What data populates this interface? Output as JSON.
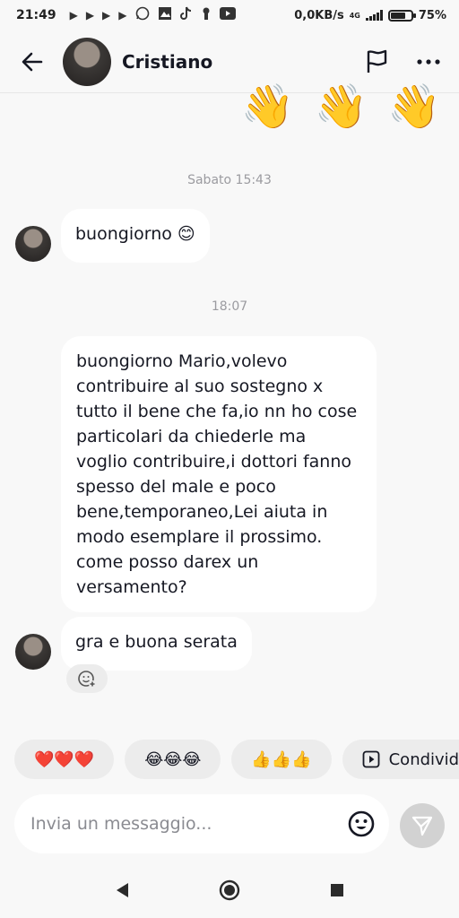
{
  "status_bar": {
    "time": "21:49",
    "net_speed": "0,0KB/s",
    "network_type": "4G",
    "battery": "75%",
    "battery_level": 0.75,
    "icons": [
      "play-icon",
      "play-icon",
      "play-icon",
      "play-icon",
      "whatsapp-icon",
      "image-icon",
      "tiktok-icon",
      "keyhole-icon",
      "youtube-icon"
    ]
  },
  "header": {
    "name": "Cristiano",
    "back_icon": "arrow-left-icon",
    "report_icon": "flag-icon",
    "more_icon": "more-horizontal-icon"
  },
  "chat": {
    "top_reactions": [
      "👋",
      "👋",
      "👋"
    ],
    "timestamp_1": "Sabato 15:43",
    "message_1": "buongiorno 😊",
    "timestamp_2": "18:07",
    "message_2": "buongiorno Mario,volevo contribuire al suo sostegno x tutto il bene che fa,io nn ho cose particolari da chiederle ma voglio contribuire,i dottori fanno spesso del male e poco bene,temporaneo,Lei aiuta in modo esemplare il prossimo. come posso darex un versamento?",
    "message_3": "gra e buona serata"
  },
  "quick_replies": [
    "❤️❤️❤️",
    "😂😂😂",
    "👍👍👍",
    "Condividi po"
  ],
  "composer": {
    "placeholder": "Invia un messaggio...",
    "value": ""
  },
  "colors": {
    "background": "#f8f8f8",
    "bubble": "#ffffff",
    "chip": "#ececec",
    "send_disabled": "#d2d2d2",
    "text": "#161823",
    "muted": "#9b9ba0"
  }
}
